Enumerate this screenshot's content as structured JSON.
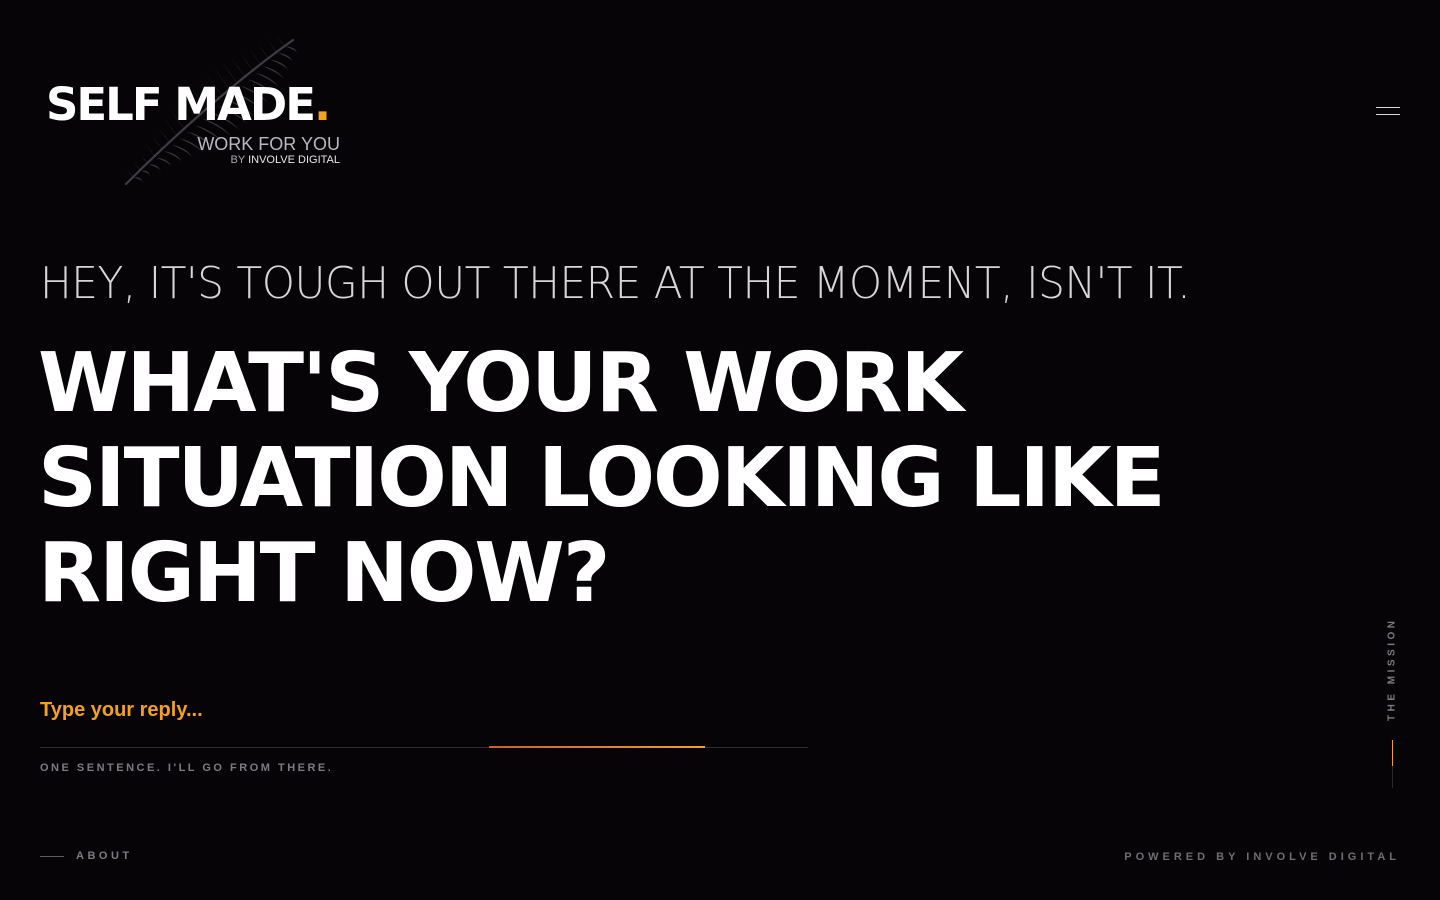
{
  "brand": {
    "name": "SELF MADE",
    "dot": ".",
    "tagline": "WORK FOR YOU",
    "by_prefix": "BY",
    "by_company": "INVOLVE DIGITAL",
    "accent_color": "#f4a024"
  },
  "header": {
    "menu_icon": "hamburger-menu-icon"
  },
  "hero": {
    "intro": "HEY, IT'S TOUGH OUT THERE AT THE MOMENT, ISN'T IT.",
    "question_lines": [
      "WHAT'S YOUR WORK",
      "SITUATION LOOKING LIKE",
      "RIGHT NOW?"
    ]
  },
  "reply": {
    "placeholder": "Type your reply...",
    "value": "",
    "hint": "ONE SENTENCE. I'LL GO FROM THERE."
  },
  "side_nav": {
    "label": "THE MISSION"
  },
  "footer": {
    "about_label": "ABOUT",
    "powered_by": "POWERED BY INVOLVE DIGITAL"
  }
}
